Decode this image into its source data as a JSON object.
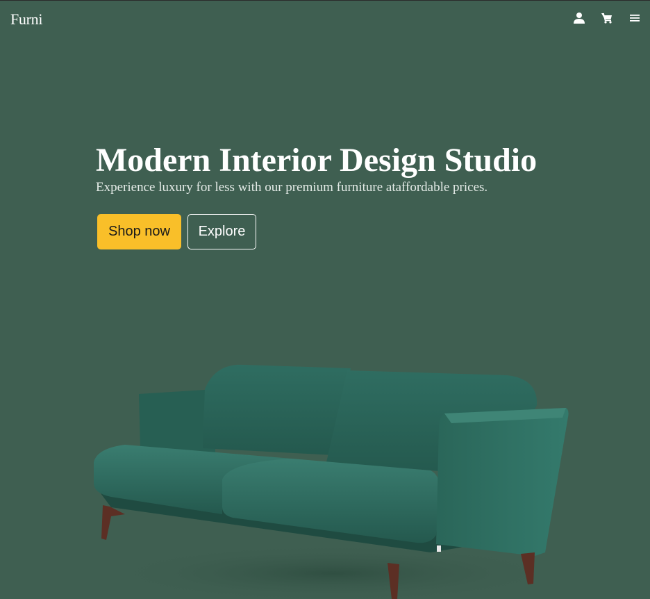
{
  "navbar": {
    "brand": "Furni",
    "icons": [
      "user-icon",
      "cart-icon",
      "menu-icon"
    ]
  },
  "hero": {
    "title": "Modern Interior Design Studio",
    "subtitle": "Experience luxury for less with our premium furniture ataffordable prices.",
    "primary_button": "Shop now",
    "secondary_button": "Explore"
  },
  "colors": {
    "background": "#3f5f51",
    "accent": "#f9bf29",
    "sofa": "#2e6b5e"
  }
}
